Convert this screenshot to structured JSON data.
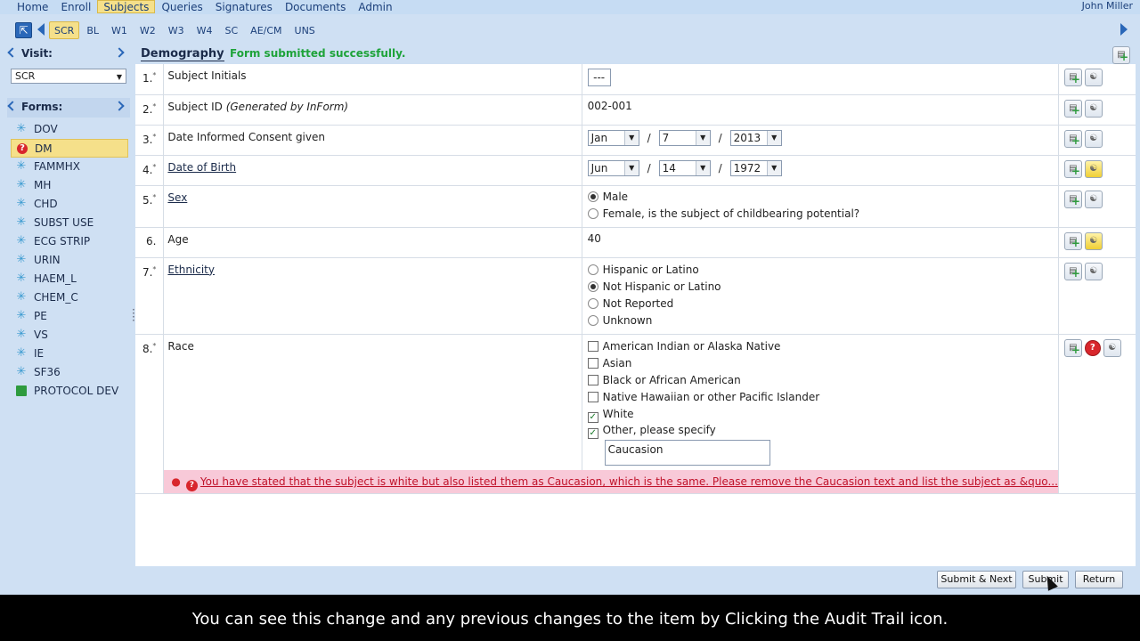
{
  "topnav": {
    "items": [
      "Home",
      "Enroll",
      "Subjects",
      "Queries",
      "Signatures",
      "Documents",
      "Admin"
    ],
    "active": "Subjects",
    "user": "John Miller"
  },
  "visits": {
    "tabs": [
      "SCR",
      "BL",
      "W1",
      "W2",
      "W3",
      "W4",
      "SC",
      "AE/CM",
      "UNS"
    ],
    "active": "SCR"
  },
  "sidebar": {
    "visit_label": "Visit:",
    "visit_selected": "SCR",
    "forms_label": "Forms:",
    "forms": [
      {
        "name": "DOV",
        "icon": "asterisk-icon"
      },
      {
        "name": "DM",
        "icon": "query-icon",
        "active": true
      },
      {
        "name": "FAMMHX",
        "icon": "asterisk-icon"
      },
      {
        "name": "MH",
        "icon": "asterisk-icon"
      },
      {
        "name": "CHD",
        "icon": "asterisk-icon"
      },
      {
        "name": "SUBST USE",
        "icon": "asterisk-icon"
      },
      {
        "name": "ECG STRIP",
        "icon": "asterisk-icon"
      },
      {
        "name": "URIN",
        "icon": "asterisk-icon"
      },
      {
        "name": "HAEM_L",
        "icon": "asterisk-icon"
      },
      {
        "name": "CHEM_C",
        "icon": "asterisk-icon"
      },
      {
        "name": "PE",
        "icon": "asterisk-icon"
      },
      {
        "name": "VS",
        "icon": "asterisk-icon"
      },
      {
        "name": "IE",
        "icon": "asterisk-icon"
      },
      {
        "name": "SF36",
        "icon": "asterisk-icon"
      },
      {
        "name": "PROTOCOL DEV",
        "icon": "green-square-icon"
      }
    ]
  },
  "form": {
    "title": "Demography",
    "status_msg": "Form submitted successfully.",
    "items": {
      "q1": {
        "num": "1.",
        "label": "Subject Initials",
        "value": "---"
      },
      "q2": {
        "num": "2.",
        "label": "Subject ID",
        "label_note": "(Generated by InForm)",
        "value": "002-001"
      },
      "q3": {
        "num": "3.",
        "label": "Date Informed Consent given",
        "month": "Jan",
        "day": "7",
        "year": "2013"
      },
      "q4": {
        "num": "4.",
        "label": "Date of Birth",
        "month": "Jun",
        "day": "14",
        "year": "1972"
      },
      "q5": {
        "num": "5.",
        "label": "Sex",
        "opt1": "Male",
        "opt2": "Female, is the subject of childbearing potential?"
      },
      "q6": {
        "num": "6.",
        "label": "Age",
        "value": "40"
      },
      "q7": {
        "num": "7.",
        "label": "Ethnicity",
        "opt1": "Hispanic or Latino",
        "opt2": "Not Hispanic or Latino",
        "opt3": "Not Reported",
        "opt4": "Unknown"
      },
      "q8": {
        "num": "8.",
        "label": "Race",
        "opt1": "American Indian or Alaska Native",
        "opt2": "Asian",
        "opt3": "Black or African American",
        "opt4": "Native Hawaiian or other Pacific Islander",
        "opt5": "White",
        "opt6": "Other, please specify",
        "specify_value": "Caucasion"
      }
    },
    "required_mark": "*",
    "query_text": "You have stated that the subject is white but also listed them as Caucasion, which is the same. Please remove the Caucasion text and list the subject as &quo..."
  },
  "buttons": {
    "submit_next": "Submit & Next",
    "submit": "Submit",
    "return": "Return"
  },
  "caption": "You can see this change and any previous changes to the item by Clicking the Audit Trail icon.",
  "colors": {
    "success": "#1ea33a",
    "query_red": "#d8262c",
    "highlight": "#f5e08a",
    "error_bg": "#f8c9d8"
  }
}
